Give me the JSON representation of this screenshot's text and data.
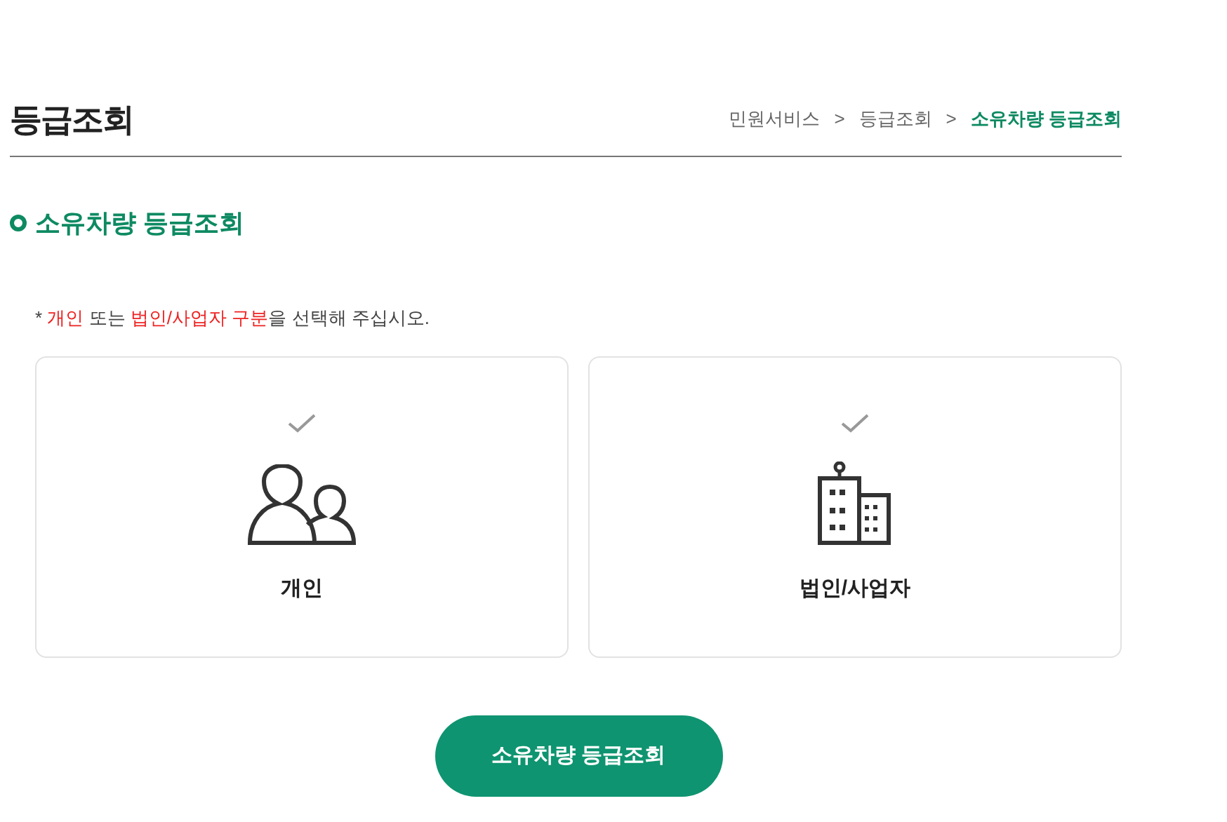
{
  "page_title": "등급조회",
  "breadcrumb": [
    {
      "label": "민원서비스",
      "current": false
    },
    {
      "label": ">",
      "current": false
    },
    {
      "label": "등급조회",
      "current": false
    },
    {
      "label": ">",
      "current": false
    },
    {
      "label": "소유차량 등급조회",
      "current": true
    }
  ],
  "section_title": "소유차량 등급조회",
  "notice": [
    {
      "text": "*",
      "highlight": false
    },
    {
      "text": " 개인",
      "highlight": true
    },
    {
      "text": " 또는 ",
      "highlight": false
    },
    {
      "text": "법인/사업자 구분",
      "highlight": true
    },
    {
      "text": "을 선택해 주십시오.",
      "highlight": false
    }
  ],
  "options": [
    {
      "kind": "person",
      "label": "개인",
      "selected": false
    },
    {
      "kind": "company",
      "label": "법인/사업자",
      "selected": false
    }
  ],
  "submit_button": "소유차량 등급조회"
}
